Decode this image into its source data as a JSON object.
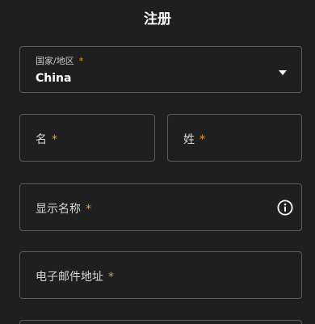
{
  "page": {
    "title": "注册"
  },
  "form": {
    "country": {
      "label": "国家/地区",
      "required_mark": "*",
      "value": "China"
    },
    "first_name": {
      "label": "名",
      "required_mark": "*"
    },
    "last_name": {
      "label": "姓",
      "required_mark": "*"
    },
    "display_name": {
      "label": "显示名称",
      "required_mark": "*"
    },
    "email": {
      "label": "电子邮件地址",
      "required_mark": "*"
    }
  },
  "colors": {
    "background": "#1f1f1f",
    "border": "#5c5c5c",
    "required_accent": "#e2a23b",
    "text": "#ffffff"
  }
}
